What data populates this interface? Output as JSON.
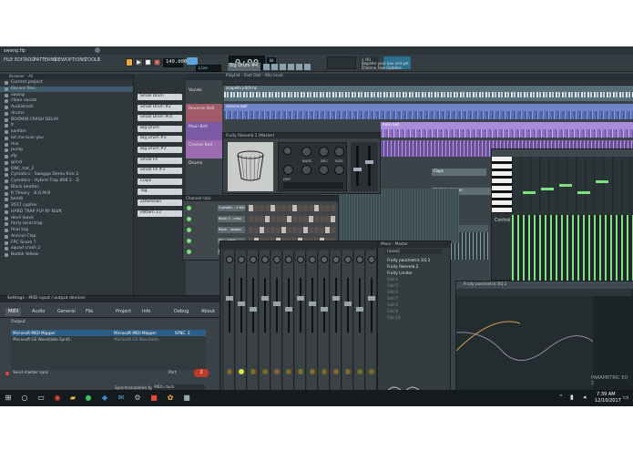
{
  "window": {
    "title": "swang.flp"
  },
  "menu": [
    "FILE",
    "EDIT",
    "ADD",
    "PATTERNS",
    "VIEW",
    "OPTIONS",
    "TOOLS",
    "?"
  ],
  "transport": {
    "tempo": "140.000",
    "time": "0:00",
    "time_sub": "00",
    "pattern": "Big Drum #4",
    "cpu_label": "4 MB",
    "mem": "0"
  },
  "notice": {
    "line1": "Register your box and get",
    "line2": "Lifetime Free Updates"
  },
  "browser": {
    "header": "Browser - All",
    "items": [
      "Current project",
      "Recent files",
      "swang",
      "clean vocals",
      "Audiotrack",
      "drums",
      "BOOMIN CRASH DELAY",
      "lt",
      "sanfam",
      "let me love you",
      "mix",
      "pump",
      "sfp",
      "grind",
      "DNC_hat_2",
      "Cymatics - Swagga Demo Kick 2",
      "Cymatics - Hybrid Trap 808 2 - D",
      "Black beatles",
      "R Theory - B.O.M.B",
      "bomb",
      "2017 cypher",
      "HARD TRAP FLP BY BLVK",
      "devil leave",
      "fairly local trap",
      "final tag",
      "Animal Clap",
      "FPC Snare 7",
      "squad crash 2",
      "Bodak Yellow"
    ]
  },
  "channels": [
    "Small Drum",
    "Small Drum #2",
    "Small Drum #/4",
    "Big Drum",
    "Big Drum #3",
    "Big Drum #2",
    "Small FX",
    "Small FX #3",
    "Claps",
    "Tag",
    "ZDSession",
    "Pattern 13"
  ],
  "playlist": {
    "title": "Playlist - Fast Dist - Mix level",
    "tracks": [
      "Vocals",
      "Reverse Bell",
      "Main Bell",
      "Chorus Bell",
      "Drums"
    ],
    "clip_vocal": "acapella pitch hs",
    "clip_rev": "reverse bell",
    "clip_main": "main bell",
    "clip_claps": "Claps",
    "clip_sub": "FX_Subsidiaires",
    "clip_cym": "Cymatics - Swagga Demo Impact 1"
  },
  "plugin": {
    "title": "Fruity Reeverb 2 (Master)",
    "knobs": [
      "BASS",
      "DEC",
      "SIZE",
      "DIFF"
    ]
  },
  "channel_rack": {
    "title": "Channel rack",
    "rows": [
      "Cymatic - s Kick 2",
      "Rock 1 - crop",
      "Rock - stomp",
      "Ssl - pitch",
      "Gift - Lp"
    ]
  },
  "pianoroll": {
    "label": "Control"
  },
  "mixer": {
    "title": "Mixer - Master",
    "current": "(none)",
    "slots": [
      "Fruity parametric EQ 2",
      "Fruity Reeverb 2",
      "Fruity Limiter",
      "Slot 4",
      "Slot 5",
      "Slot 6",
      "Slot 7",
      "Slot 8",
      "Slot 9",
      "Slot 10"
    ],
    "footer": "(none)"
  },
  "eq": {
    "title": "Fruity parametric EQ 2",
    "label": "PARAMETRIC EQ 2"
  },
  "settings": {
    "title": "Settings - MIDI input / output devices",
    "tabs": [
      "MIDI",
      "Audio",
      "General",
      "File",
      "Project",
      "Info",
      "Debug",
      "About"
    ],
    "output_label": "Output",
    "devices": [
      {
        "name": "Microsoft MIDI Mapper",
        "driver": "Microsoft MIDI Mapper",
        "port": "SYNC",
        "num": "2"
      },
      {
        "name": "Microsoft GS Wavetable Synth",
        "driver": "Microsoft GS Wavetable",
        "port": "",
        "num": ""
      }
    ],
    "send_sync": "Send master sync",
    "port_label": "Port",
    "port_value": "2",
    "sync_type_label": "Synchronization type",
    "sync_type_value": "MIDI clock",
    "input_label": "Input"
  },
  "taskbar": {
    "time": "7:39 AM",
    "date": "12/10/2017"
  },
  "colors": {
    "accent": "#a98bd8",
    "bg": "#3b4449",
    "blue_clip": "#6f84c9",
    "green": "#7ee07e"
  }
}
